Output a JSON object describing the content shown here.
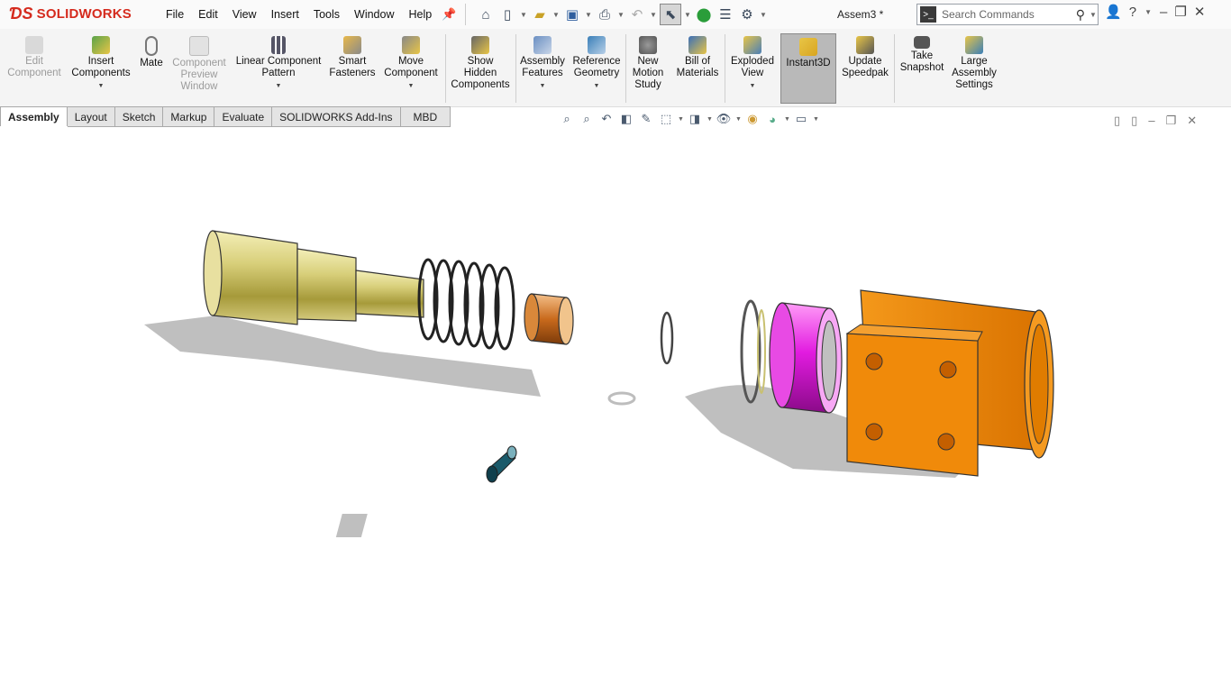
{
  "app": {
    "brand": "SOLIDWORKS",
    "document_title": "Assem3 *"
  },
  "menu": [
    "File",
    "Edit",
    "View",
    "Insert",
    "Tools",
    "Window",
    "Help"
  ],
  "search": {
    "placeholder": "Search Commands"
  },
  "commands": [
    {
      "label": "Edit\nComponent",
      "icon": "edit-component-icon",
      "disabled": true
    },
    {
      "label": "Insert\nComponents",
      "icon": "insert-components-icon",
      "dropdown": true
    },
    {
      "label": "Mate",
      "icon": "paperclip-icon"
    },
    {
      "label": "Component\nPreview\nWindow",
      "icon": "preview-window-icon",
      "disabled": true
    },
    {
      "label": "Linear Component\nPattern",
      "icon": "linear-pattern-icon",
      "dropdown": true
    },
    {
      "label": "Smart\nFasteners",
      "icon": "smart-fasteners-icon"
    },
    {
      "label": "Move\nComponent",
      "icon": "move-component-icon",
      "dropdown": true
    },
    {
      "label": "Show\nHidden\nComponents",
      "icon": "show-hidden-icon"
    },
    {
      "label": "Assembly\nFeatures",
      "icon": "assembly-features-icon",
      "dropdown": true
    },
    {
      "label": "Reference\nGeometry",
      "icon": "reference-geometry-icon",
      "dropdown": true
    },
    {
      "label": "New\nMotion\nStudy",
      "icon": "motion-study-icon"
    },
    {
      "label": "Bill of\nMaterials",
      "icon": "bom-icon"
    },
    {
      "label": "Exploded\nView",
      "icon": "exploded-view-icon",
      "dropdown": true
    },
    {
      "label": "Instant3D",
      "icon": "instant3d-icon",
      "active": true
    },
    {
      "label": "Update\nSpeedpak",
      "icon": "speedpak-icon"
    },
    {
      "label": "Take\nSnapshot",
      "icon": "camera-icon"
    },
    {
      "label": "Large\nAssembly\nSettings",
      "icon": "large-assembly-icon"
    }
  ],
  "tabs": [
    "Assembly",
    "Layout",
    "Sketch",
    "Markup",
    "Evaluate",
    "SOLIDWORKS Add-Ins",
    "MBD"
  ],
  "colors": {
    "brand_red": "#d52b1e",
    "housing_orange": "#f28a00",
    "bushing_magenta": "#e21be0",
    "sleeve_copper": "#c96a1c",
    "plunger_brass": "#d8cf7a",
    "pin_teal": "#1a5a6a"
  }
}
